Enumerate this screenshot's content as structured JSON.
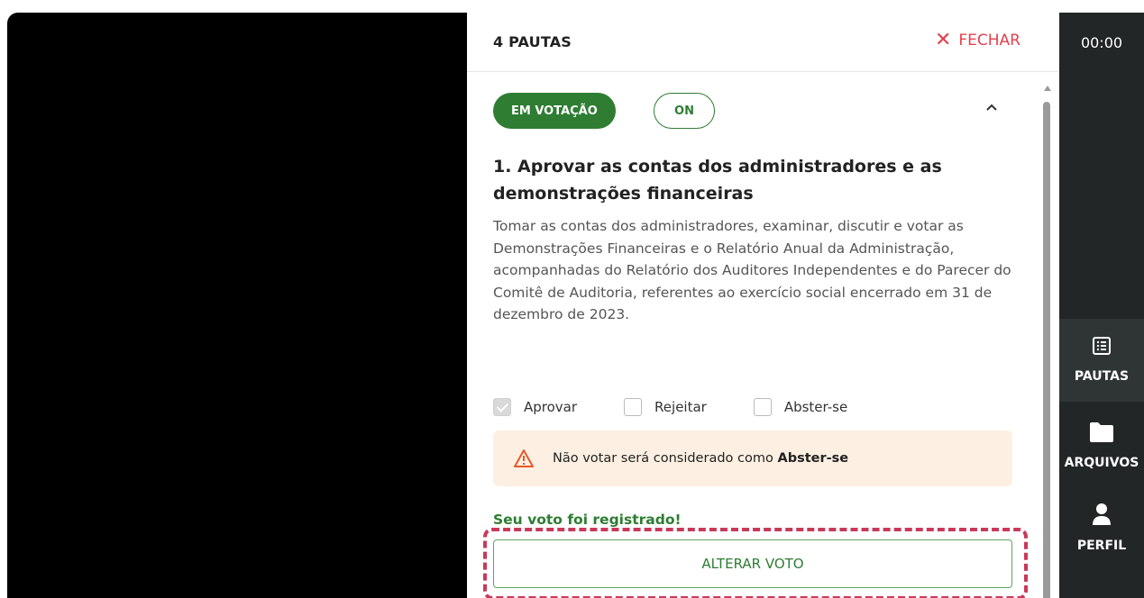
{
  "panel": {
    "title": "4 PAUTAS",
    "close_label": "FECHAR",
    "close_icon": "close-icon"
  },
  "item": {
    "status_badge": "EM VOTAÇÃO",
    "mode_badge": "ON",
    "title": "1. Aprovar as contas dos administradores e as demonstrações financeiras",
    "description": "Tomar as contas dos administradores, examinar, discutir e votar as Demonstrações Financeiras e o Relatório Anual da Administração, acompanhadas do Relatório dos Auditores Independentes e do Parecer do Comitê de Auditoria, referentes ao exercício social encerrado em 31 de dezembro de 2023.",
    "options": [
      {
        "label": "Aprovar",
        "checked": true
      },
      {
        "label": "Rejeitar",
        "checked": false
      },
      {
        "label": "Abster-se",
        "checked": false
      }
    ],
    "warning_prefix": "Não votar será considerado como ",
    "warning_bold": "Abster-se",
    "registered_message": "Seu voto foi registrado!",
    "change_vote_label": "ALTERAR VOTO"
  },
  "rail": {
    "timer": "00:00",
    "items": [
      {
        "label": "PAUTAS",
        "icon": "list-icon"
      },
      {
        "label": "ARQUIVOS",
        "icon": "folder-icon"
      },
      {
        "label": "PERFIL",
        "icon": "person-icon"
      }
    ]
  },
  "colors": {
    "primary_green": "#2e7d32",
    "close_red": "#e5404e",
    "highlight": "#c8395a",
    "warning_bg": "#fdf0e2",
    "rail_bg": "#222627"
  }
}
